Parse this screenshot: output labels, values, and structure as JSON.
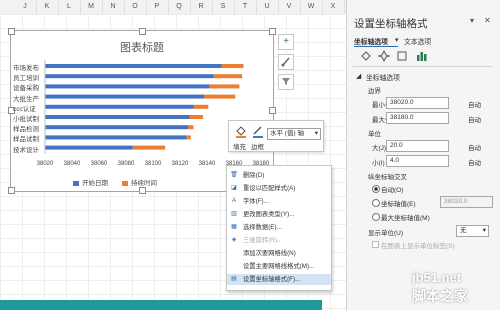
{
  "sheet": {
    "columns": [
      "J",
      "K",
      "L",
      "M",
      "N",
      "O",
      "P",
      "Q",
      "R",
      "S",
      "T",
      "U",
      "V",
      "W",
      "X"
    ]
  },
  "chart": {
    "title": "图表标题",
    "categories": [
      "市场发布",
      "员工培训",
      "设备采购",
      "大批生产",
      "ccc认证",
      "小批试制",
      "样品检测",
      "样品试制",
      "技术设计"
    ],
    "x_ticks": [
      "38020",
      "38040",
      "38060",
      "38080",
      "38100",
      "38120",
      "38140",
      "38160",
      "38180"
    ],
    "legend": {
      "start": "开始日期",
      "duration": "持续时间"
    }
  },
  "chart_data": {
    "type": "bar",
    "orientation": "horizontal",
    "stacked": true,
    "title": "图表标题",
    "categories": [
      "市场发布",
      "员工培训",
      "设备采购",
      "大批生产",
      "ccc认证",
      "小批试制",
      "样品检测",
      "样品试制",
      "技术设计"
    ],
    "xlim": [
      38020,
      38180
    ],
    "series": [
      {
        "name": "开始日期",
        "values": [
          38151,
          38145,
          38142,
          38138,
          38130,
          38127,
          38126,
          38125,
          38085
        ]
      },
      {
        "name": "持续时间",
        "values": [
          16,
          21,
          22,
          23,
          11,
          10,
          4,
          3,
          24
        ]
      }
    ],
    "colors": {
      "start": "#4472c4",
      "duration": "#ed7d31"
    },
    "legend_position": "bottom",
    "grid": false
  },
  "mini_toolbar": {
    "axis_select": "水平 (值) 轴",
    "fill_label": "填充",
    "border_label": "边框"
  },
  "context_menu": {
    "items": [
      {
        "label": "删除(D)",
        "icon": "delete-icon",
        "disabled": false
      },
      {
        "label": "重设以匹配样式(A)",
        "icon": "reset-style-icon",
        "disabled": false
      },
      {
        "label": "字体(F)...",
        "icon": "font-icon",
        "disabled": false
      },
      {
        "label": "更改图表类型(Y)...",
        "icon": "chart-type-icon",
        "disabled": false
      },
      {
        "label": "选择数据(E)...",
        "icon": "select-data-icon",
        "disabled": false
      },
      {
        "label": "三维旋转(R)...",
        "icon": "rotate-3d-icon",
        "disabled": true
      },
      {
        "label": "添加次要网格线(N)",
        "icon": "",
        "disabled": false
      },
      {
        "label": "设置主要网格线格式(M)...",
        "icon": "",
        "disabled": false
      },
      {
        "label": "设置坐标轴格式(F)...",
        "icon": "format-axis-icon",
        "disabled": false
      }
    ]
  },
  "pane": {
    "title": "设置坐标轴格式",
    "tabs": [
      "坐标轴选项",
      "文本选项"
    ],
    "section": "坐标轴选项",
    "bounds_label": "边界",
    "min_label": "最小值(B)",
    "min_value": "38020.0",
    "max_label": "最大值(M)",
    "max_value": "38180.0",
    "auto": "自动",
    "units_label": "单位",
    "major_label": "大(J)",
    "major_value": "20.0",
    "minor_label": "小(I)",
    "minor_value": "4.0",
    "cross_label": "纵坐标轴交叉",
    "cross_auto": "自动(O)",
    "cross_value_label": "坐标轴值(E)",
    "cross_value": "38020.0",
    "cross_max": "最大坐标轴值(M)",
    "display_units_label": "显示单位(U)",
    "display_units_value": "无",
    "show_units_label": "在图表上显示单位标签(S)"
  },
  "watermark": {
    "site": "jb51.net",
    "name": "脚本之家"
  }
}
